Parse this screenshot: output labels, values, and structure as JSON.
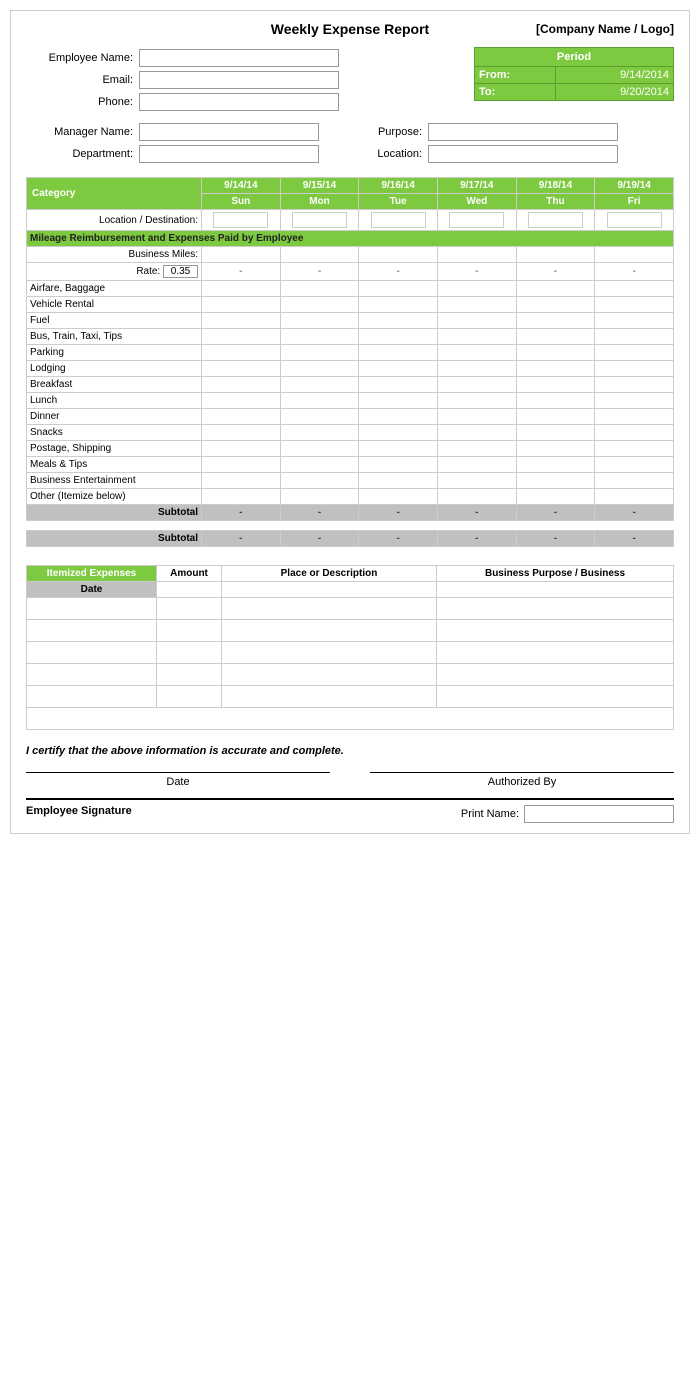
{
  "header": {
    "title": "Weekly Expense Report",
    "company": "[Company Name / Logo]"
  },
  "employee": {
    "name_label": "Employee Name:",
    "email_label": "Email:",
    "phone_label": "Phone:"
  },
  "period": {
    "label": "Period",
    "from_label": "From:",
    "from_value": "9/14/2014",
    "to_label": "To:",
    "to_value": "9/20/2014"
  },
  "manager": {
    "name_label": "Manager Name:",
    "department_label": "Department:",
    "purpose_label": "Purpose:",
    "location_label": "Location:"
  },
  "table": {
    "category_label": "Category",
    "dates": [
      "9/14/14",
      "9/15/14",
      "9/16/14",
      "9/17/14",
      "9/18/14",
      "9/19/14"
    ],
    "days": [
      "Sun",
      "Mon",
      "Tue",
      "Wed",
      "Thu",
      "Fri"
    ],
    "location_row": "Location / Destination:",
    "mileage_section": "Mileage Reimbursement and Expenses Paid by Employee",
    "business_miles_label": "Business Miles:",
    "rate_label": "Rate:",
    "rate_value": "0.35",
    "dash": "-",
    "categories": [
      "Airfare, Baggage",
      "Vehicle Rental",
      "Fuel",
      "Bus, Train, Taxi, Tips",
      "Parking",
      "Lodging",
      "Breakfast",
      "Lunch",
      "Dinner",
      "Snacks",
      "Postage, Shipping",
      "Meals & Tips",
      "Business Entertainment",
      "Other (Itemize below)"
    ],
    "subtotal_label": "Subtotal"
  },
  "itemized": {
    "header": "Itemized Expenses",
    "amount_label": "Amount",
    "place_label": "Place or Description",
    "business_label": "Business Purpose / Business",
    "date_label": "Date",
    "rows": 6
  },
  "certification": {
    "text": "I certify that the above information is accurate and complete."
  },
  "signature": {
    "date_label": "Date",
    "authorized_label": "Authorized By",
    "employee_sig_label": "Employee Signature",
    "print_name_label": "Print Name:"
  }
}
